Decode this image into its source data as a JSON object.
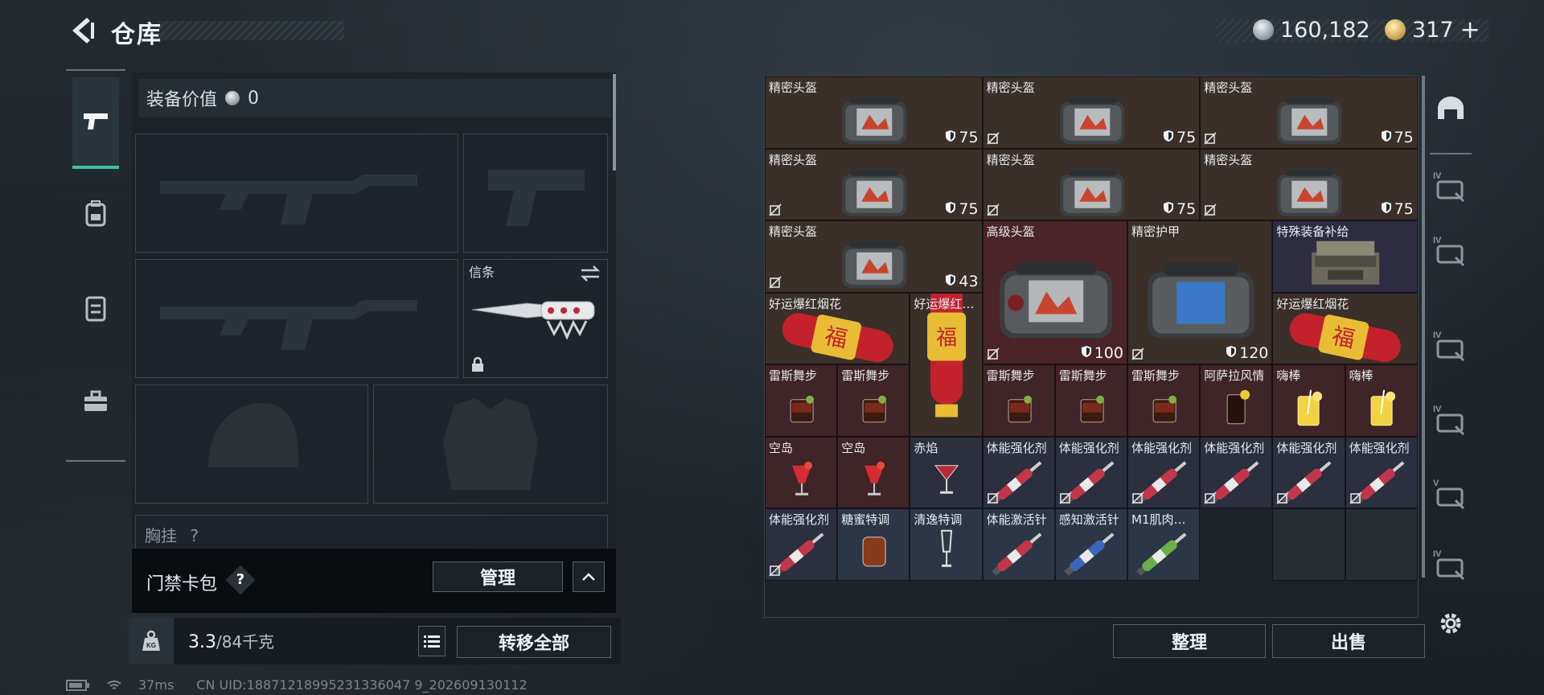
{
  "header": {
    "title": "仓库",
    "currencies": [
      {
        "icon": "silver-coin-icon",
        "value": "160,182"
      },
      {
        "icon": "gold-coin-icon",
        "value": "317",
        "suffix": "+"
      }
    ]
  },
  "left_tabs": [
    {
      "icon": "pistol-icon",
      "active": true
    },
    {
      "icon": "backpack-icon",
      "active": false
    },
    {
      "icon": "vest-icon",
      "active": false
    },
    {
      "icon": "toolbox-icon",
      "active": false
    }
  ],
  "equipment": {
    "value_label": "装备价值",
    "value": "0",
    "melee_label": "信条",
    "chest_label": "胸挂",
    "chest_help": "?"
  },
  "keycard": {
    "label": "门禁卡包",
    "help": "?",
    "manage": "管理"
  },
  "capacity": {
    "current": "3.3",
    "max": "/84千克",
    "transfer_all": "转移全部"
  },
  "status_bar": {
    "ping": "37ms",
    "uid": "CN UID:18871218995231336047 9_202609130112"
  },
  "inventory": {
    "items": [
      {
        "name": "精密头盔",
        "dur": "75",
        "bg": "#3a2f29",
        "img": "helmet"
      },
      {
        "name": "精密头盔",
        "dur": "75",
        "bg": "#3a2f29",
        "img": "helmet",
        "nosell": true
      },
      {
        "name": "精密头盔",
        "dur": "75",
        "bg": "#3a2f29",
        "img": "helmet",
        "nosell": true
      },
      {
        "name": "精密头盔",
        "dur": "75",
        "bg": "#3a2f29",
        "img": "helmet",
        "nosell": true
      },
      {
        "name": "精密头盔",
        "dur": "75",
        "bg": "#3a2f29",
        "img": "helmet",
        "nosell": true
      },
      {
        "name": "精密头盔",
        "dur": "75",
        "bg": "#3a2f29",
        "img": "helmet",
        "nosell": true
      },
      {
        "name": "精密头盔",
        "dur": "43",
        "bg": "#3a2f29",
        "img": "helmet",
        "nosell": true
      },
      {
        "name": "高级头盔",
        "dur": "100",
        "bg": "#4a2428",
        "img": "helmet-big",
        "nosell": true
      },
      {
        "name": "精密护甲",
        "dur": "120",
        "bg": "#3a2f29",
        "img": "armor",
        "nosell": true
      },
      {
        "name": "特殊装备补给",
        "dur": "",
        "bg": "#2e2c40",
        "img": "crate"
      },
      {
        "name": "好运爆红烟花",
        "dur": "",
        "bg": "#3a2f29",
        "img": "firework-h"
      },
      {
        "name": "好运爆红…",
        "dur": "",
        "bg": "#3a2f29",
        "img": "firework-v"
      },
      {
        "name": "好运爆红烟花",
        "dur": "",
        "bg": "#3a2f29",
        "img": "firework-h"
      },
      {
        "name": "雷斯舞步",
        "bg": "#3f2428",
        "img": "drink-dark"
      },
      {
        "name": "雷斯舞步",
        "bg": "#3f2428",
        "img": "drink-dark"
      },
      {
        "name": "雷斯舞步",
        "bg": "#3f2428",
        "img": "drink-dark"
      },
      {
        "name": "雷斯舞步",
        "bg": "#3f2428",
        "img": "drink-dark"
      },
      {
        "name": "雷斯舞步",
        "bg": "#3f2428",
        "img": "drink-dark"
      },
      {
        "name": "阿萨拉风情",
        "bg": "#3f2428",
        "img": "drink-cola"
      },
      {
        "name": "嗨棒",
        "bg": "#3f2428",
        "img": "drink-yellow"
      },
      {
        "name": "嗨棒",
        "bg": "#3f2428",
        "img": "drink-yellow"
      },
      {
        "name": "空岛",
        "bg": "#3f2428",
        "img": "cocktail-red"
      },
      {
        "name": "空岛",
        "bg": "#3f2428",
        "img": "cocktail-red"
      },
      {
        "name": "赤焰",
        "bg": "#2b2f3e",
        "img": "martini"
      },
      {
        "name": "体能强化剂",
        "bg": "#2b2f3e",
        "img": "syringe-red",
        "nosell": true
      },
      {
        "name": "体能强化剂",
        "bg": "#2b2f3e",
        "img": "syringe-red",
        "nosell": true
      },
      {
        "name": "体能强化剂",
        "bg": "#2b2f3e",
        "img": "syringe-red",
        "nosell": true
      },
      {
        "name": "体能强化剂",
        "bg": "#2b2f3e",
        "img": "syringe-red",
        "nosell": true
      },
      {
        "name": "体能强化剂",
        "bg": "#2b2f3e",
        "img": "syringe-red",
        "nosell": true
      },
      {
        "name": "体能强化剂",
        "bg": "#2b2f3e",
        "img": "syringe-red",
        "nosell": true
      },
      {
        "name": "体能强化剂",
        "bg": "#2b2f3e",
        "img": "syringe-red",
        "nosell": true
      },
      {
        "name": "糖蜜特调",
        "bg": "#2c3646",
        "img": "glass-brown"
      },
      {
        "name": "清逸特调",
        "bg": "#2c3646",
        "img": "flute"
      },
      {
        "name": "体能激活针",
        "bg": "#2c3646",
        "img": "syringe-red"
      },
      {
        "name": "感知激活针",
        "bg": "#2c3646",
        "img": "syringe-blue"
      },
      {
        "name": "M1肌肉…",
        "bg": "#2c3646",
        "img": "syringe-green"
      }
    ]
  },
  "actions": {
    "sort": "整理",
    "sell": "出售"
  },
  "right_tabs": [
    {
      "icon": "helmet-slot-icon"
    },
    {
      "icon": "tier4-helmet-cart-icon",
      "tier": "IV"
    },
    {
      "icon": "tier4-helmet-cart-icon",
      "tier": "IV"
    },
    {
      "icon": "tier4-medkit-icon",
      "tier": "IV"
    },
    {
      "icon": "tier4-helmet-cart-icon",
      "tier": "IV"
    },
    {
      "icon": "tier5-box-icon",
      "tier": "V"
    },
    {
      "icon": "tier4-folder-icon",
      "tier": "IV"
    },
    {
      "icon": "gear-icon"
    }
  ],
  "colors": {
    "accent": "#3fc3a3",
    "panel": "#1e252b"
  }
}
